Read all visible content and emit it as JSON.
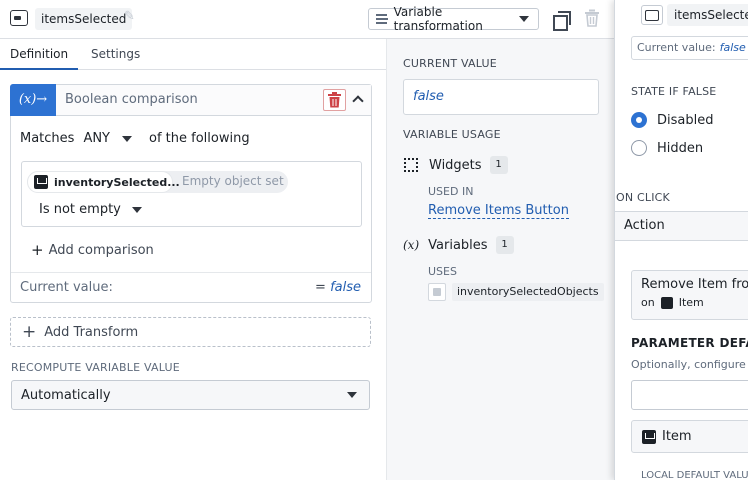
{
  "header": {
    "variable_name": "itemsSelected",
    "transform_type": "Variable transformation"
  },
  "tabs": [
    {
      "label": "Definition",
      "active": true
    },
    {
      "label": "Settings",
      "active": false
    }
  ],
  "boolean_card": {
    "badge": "(x)→",
    "title": "Boolean comparison",
    "matches_prefix": "Matches",
    "matches_value": "ANY",
    "matches_suffix": "of the following",
    "comparison": {
      "object": "inventorySelected...",
      "object_placeholder": "Empty object set",
      "operator": "Is not empty"
    },
    "add_comparison": "Add comparison",
    "current_value_label": "Current value:",
    "current_value_prefix": "=",
    "current_value": "false"
  },
  "add_transform": "Add Transform",
  "recompute": {
    "label": "RECOMPUTE VARIABLE VALUE",
    "value": "Automatically"
  },
  "middle": {
    "current_value_title": "CURRENT VALUE",
    "current_value": "false",
    "usage_title": "VARIABLE USAGE",
    "widgets_label": "Widgets",
    "widgets_count": "1",
    "used_in_label": "USED IN",
    "used_in_link": "Remove Items Button",
    "variables_icon": "(x)",
    "variables_label": "Variables",
    "variables_count": "1",
    "uses_label": "USES",
    "uses_item": "inventorySelectedObjects"
  },
  "right_panel": {
    "variable_name": "itemsSelected",
    "current_value_label": "Current value:",
    "current_value": "false",
    "state_if_false": "STATE IF FALSE",
    "option_disabled": "Disabled",
    "option_hidden": "Hidden",
    "selected_option": "Disabled",
    "on_click": "ON CLICK",
    "action": "Action",
    "card_line1": "Remove Item from",
    "card_on": "on",
    "card_item": "Item",
    "param_title": "PARAMETER DEFAUL",
    "param_desc": "Optionally, configure loc",
    "item_label": "Item",
    "local_default": "LOCAL DEFAULT VALU"
  },
  "colors": {
    "accent": "#2d72d2",
    "link": "#215db0",
    "danger": "#cd4246"
  }
}
